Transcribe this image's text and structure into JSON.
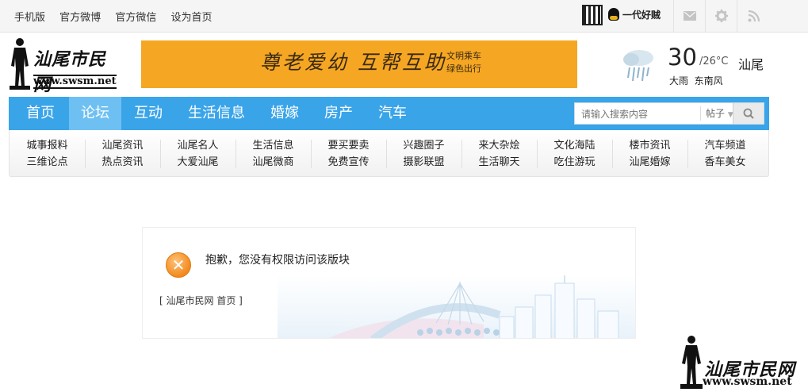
{
  "topbar": {
    "links": [
      "手机版",
      "官方微博",
      "官方微信",
      "设为首页"
    ],
    "qq_login": "一代好贼",
    "icons": [
      "mail-icon",
      "gear-icon",
      "rss-icon"
    ]
  },
  "logo": {
    "name": "汕尾市民网",
    "url": "www.swsm.net"
  },
  "banner": {
    "slogan": "尊老爱幼 互帮互助",
    "sub_line1": "文明乘车",
    "sub_line2": "绿色出行"
  },
  "weather": {
    "icon": "rain-cloud-icon",
    "temp": "30",
    "temp_low": "/26°C",
    "city": "汕尾",
    "condition": "大雨",
    "wind": "东南风"
  },
  "nav": {
    "items": [
      "首页",
      "论坛",
      "互动",
      "生活信息",
      "婚嫁",
      "房产",
      "汽车"
    ],
    "active": "论坛",
    "search_placeholder": "请输入搜索内容",
    "search_type": "帖子"
  },
  "subnav": {
    "columns": [
      [
        "城事报料",
        "三维论点"
      ],
      [
        "汕尾资讯",
        "热点资讯"
      ],
      [
        "汕尾名人",
        "大爱汕尾"
      ],
      [
        "生活信息",
        "汕尾微商"
      ],
      [
        "要买要卖",
        "免费宣传"
      ],
      [
        "兴趣圈子",
        "摄影联盟"
      ],
      [
        "来大杂烩",
        "生活聊天"
      ],
      [
        "文化海陆",
        "吃住游玩"
      ],
      [
        "楼市资讯",
        "汕尾婚嫁"
      ],
      [
        "汽车频道",
        "香车美女"
      ]
    ]
  },
  "message": {
    "text": "抱歉，您没有权限访问该版块",
    "link_open": "[ ",
    "link1": "汕尾市民网",
    "link2": "首页",
    "link_close": " ]"
  },
  "watermark": {
    "name": "汕尾市民网",
    "url": "www.swsm.net"
  },
  "colors": {
    "nav_bg": "#3aa4e9",
    "nav_active": "#6ec0f3",
    "banner_bg": "#f5a623",
    "error_icon": "#f28a1e"
  }
}
